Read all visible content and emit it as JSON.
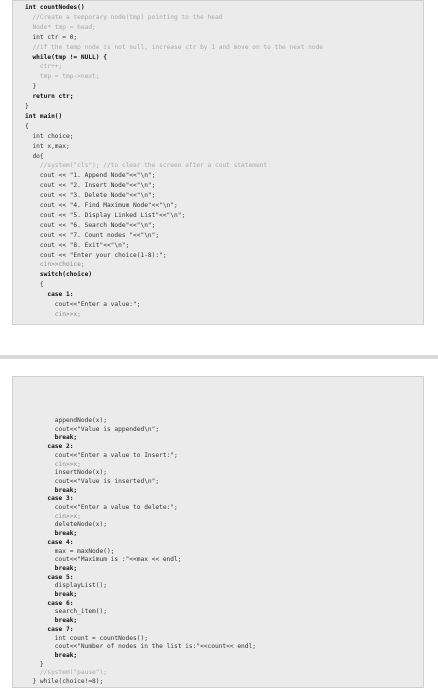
{
  "top_page": {
    "lines": [
      {
        "text": "int countNodes()",
        "style": "kw"
      },
      {
        "text": "  //Create a temporary node(tmp) pointing to the head",
        "style": "cm"
      },
      {
        "text": "  Node* tmp = head;",
        "style": "cm"
      },
      {
        "text": "  int ctr = 0;",
        "style": "normal"
      },
      {
        "text": "  //if the temp node is not null, increase ctr by 1 and move on to the next node",
        "style": "cm"
      },
      {
        "text": "  while(tmp != NULL) {",
        "style": "kw"
      },
      {
        "text": "    ctr++;",
        "style": "cm"
      },
      {
        "text": "    tmp = tmp->next;",
        "style": "cm"
      },
      {
        "text": "  }",
        "style": "normal"
      },
      {
        "text": "  return ctr;",
        "style": "kw"
      },
      {
        "text": "}",
        "style": "normal"
      },
      {
        "text": "int main()",
        "style": "kw"
      },
      {
        "text": "{",
        "style": "normal"
      },
      {
        "text": "  int choice;",
        "style": "normal"
      },
      {
        "text": "  int x,max;",
        "style": "normal"
      },
      {
        "text": "  do{",
        "style": "normal"
      },
      {
        "text": "    //system(\"cls\"); //to clear the screen after a cout statement",
        "style": "cm"
      },
      {
        "text": "    cout << \"1. Append Node\"<<\"\\n\";",
        "style": "normal"
      },
      {
        "text": "    cout << \"2. Insert Node\"<<\"\\n\";",
        "style": "normal"
      },
      {
        "text": "    cout << \"3. Delete Node\"<<\"\\n\";",
        "style": "normal"
      },
      {
        "text": "    cout << \"4. Find Maximum Node\"<<\"\\n\";",
        "style": "normal"
      },
      {
        "text": "    cout << \"5. Display Linked List\"<<\"\\n\";",
        "style": "normal"
      },
      {
        "text": "    cout << \"6. Search Node\"<<\"\\n\";",
        "style": "normal"
      },
      {
        "text": "    cout << \"7. Count nodes \"<<\"\\n\";",
        "style": "normal"
      },
      {
        "text": "    cout << \"8. Exit\"<<\"\\n\";",
        "style": "normal"
      },
      {
        "text": "    cout << \"Enter your choice(1-8):\";",
        "style": "normal"
      },
      {
        "text": "    cin>>choice;",
        "style": "st"
      },
      {
        "text": "    switch(choice)",
        "style": "kw"
      },
      {
        "text": "    {",
        "style": "normal"
      },
      {
        "text": "      case 1:",
        "style": "kw"
      },
      {
        "text": "        cout<<\"Enter a value:\";",
        "style": "normal"
      },
      {
        "text": "        cin>>x;",
        "style": "st"
      }
    ]
  },
  "bottom_page": {
    "lines": [
      {
        "text": "        appendNode(x);",
        "style": "normal"
      },
      {
        "text": "        cout<<\"Value is appended\\n\";",
        "style": "normal"
      },
      {
        "text": "        break;",
        "style": "kw"
      },
      {
        "text": "      case 2:",
        "style": "kw"
      },
      {
        "text": "        cout<<\"Enter a value to Insert:\";",
        "style": "normal"
      },
      {
        "text": "        cin>>x;",
        "style": "st"
      },
      {
        "text": "        insertNode(x);",
        "style": "normal"
      },
      {
        "text": "        cout<<\"Value is inserted\\n\";",
        "style": "normal"
      },
      {
        "text": "        break;",
        "style": "kw"
      },
      {
        "text": "      case 3:",
        "style": "kw"
      },
      {
        "text": "        cout<<\"Enter a value to delete:\";",
        "style": "normal"
      },
      {
        "text": "        cin>>x;",
        "style": "st"
      },
      {
        "text": "        deleteNode(x);",
        "style": "normal"
      },
      {
        "text": "        break;",
        "style": "kw"
      },
      {
        "text": "      case 4:",
        "style": "kw"
      },
      {
        "text": "        max = maxNode();",
        "style": "normal"
      },
      {
        "text": "        cout<<\"Maximum is :\"<<max << endl;",
        "style": "normal"
      },
      {
        "text": "        break;",
        "style": "kw"
      },
      {
        "text": "      case 5:",
        "style": "kw"
      },
      {
        "text": "        displayList();",
        "style": "normal"
      },
      {
        "text": "        break;",
        "style": "kw"
      },
      {
        "text": "      case 6:",
        "style": "kw"
      },
      {
        "text": "        search_item();",
        "style": "normal"
      },
      {
        "text": "        break;",
        "style": "kw"
      },
      {
        "text": "      case 7:",
        "style": "kw"
      },
      {
        "text": "        int count = countNodes();",
        "style": "normal"
      },
      {
        "text": "        cout<<\"Number of nodes in the list is:\"<<count<< endl;",
        "style": "normal"
      },
      {
        "text": "        break;",
        "style": "kw"
      },
      {
        "text": "    }",
        "style": "normal"
      },
      {
        "text": "    //system(\"pause\");",
        "style": "cm"
      },
      {
        "text": "  } while(choice!=8);",
        "style": "normal"
      }
    ]
  }
}
